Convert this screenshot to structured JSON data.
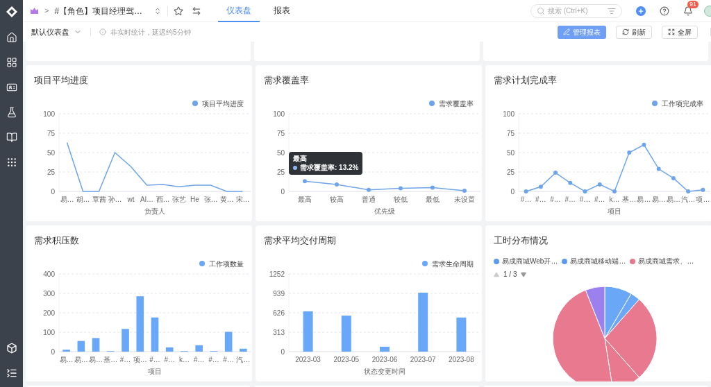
{
  "header": {
    "breadcrumb_separator": ">",
    "project_title": "#【角色】项目经理驾…",
    "tabs": [
      {
        "label": "仪表盘",
        "selected": true
      },
      {
        "label": "报表",
        "selected": false
      }
    ],
    "search": {
      "placeholder": "搜索 (Ctrl+K)"
    },
    "notification_count": "91"
  },
  "toolbar": {
    "dashboard_name": "默认仪表盘",
    "notice": "非实时统计，延迟约5分钟",
    "buttons": [
      {
        "label": "管理报表",
        "kind": "primary"
      },
      {
        "label": "刷新",
        "kind": "refresh"
      },
      {
        "label": "全屏",
        "kind": "fullscreen"
      }
    ]
  },
  "cards": [
    {
      "kind": "chart",
      "title": "项目平均进度",
      "chart_data": {
        "type": "line",
        "grid": true,
        "xlabel": "负责人",
        "categories": [
          "易…",
          "胡…",
          "覃茜",
          "孙…",
          "wt",
          "Al…",
          "西…",
          "张艺",
          "He",
          "张…",
          "黄…",
          "宋…"
        ],
        "ylim": [
          0,
          100
        ],
        "yticks": [
          0,
          25,
          50,
          75,
          100
        ],
        "series": [
          {
            "name": "项目平均进度",
            "color": "#6ea4ea",
            "marker": false,
            "values": [
              63,
              0,
              0,
              50,
              32,
              8,
              9,
              6,
              8,
              8,
              0,
              0
            ]
          }
        ]
      }
    },
    {
      "kind": "chart",
      "title": "需求覆盖率",
      "tooltip": {
        "title": "最高",
        "text": "需求覆盖率: 13.2%"
      },
      "chart_data": {
        "type": "line",
        "grid": true,
        "xlabel": "优先级",
        "categories": [
          "最高",
          "较高",
          "普通",
          "较低",
          "最低",
          "未设置"
        ],
        "ylim": [
          0,
          100
        ],
        "yticks": [
          0,
          25,
          50,
          75,
          100
        ],
        "series": [
          {
            "name": "需求覆盖率",
            "color": "#6ea4ea",
            "marker": true,
            "values": [
              13.2,
              9,
              2,
              4,
              5,
              1
            ]
          }
        ]
      }
    },
    {
      "kind": "chart",
      "title": "需求计划完成率",
      "chart_data": {
        "type": "line",
        "grid": true,
        "xlabel": "项目",
        "categories": [
          "#…",
          "#…",
          "#…",
          "#…",
          "#…",
          "#…",
          "k…",
          "基…",
          "易…",
          "易…",
          "易…",
          "汽…",
          "项…"
        ],
        "ylim": [
          0,
          100
        ],
        "yticks": [
          0,
          25,
          50,
          75,
          100
        ],
        "series": [
          {
            "name": "工作项完成率",
            "color": "#6ea4ea",
            "marker": true,
            "values": [
              0,
              6,
              24,
              11,
              0,
              9,
              0,
              50,
              60,
              29,
              17,
              0,
              2
            ]
          }
        ]
      }
    },
    {
      "kind": "chart",
      "title": "需求积压数",
      "chart_data": {
        "type": "bar",
        "grid": true,
        "xlabel": "项目",
        "categories": [
          "易…",
          "易…",
          "易…",
          "基…",
          "#…",
          "项…",
          "#…",
          "#…",
          "k…",
          "#…",
          "#…",
          "#…",
          "汽…"
        ],
        "ylim": [
          0,
          400
        ],
        "yticks": [
          0,
          100,
          200,
          300,
          400
        ],
        "series": [
          {
            "name": "工作项数量",
            "color": "#69a7f8",
            "values": [
              10,
              55,
              70,
              3,
              117,
              285,
              176,
              22,
              3,
              33,
              3,
              102,
              15
            ]
          }
        ]
      }
    },
    {
      "kind": "chart",
      "title": "需求平均交付周期",
      "chart_data": {
        "type": "bar",
        "grid": true,
        "xlabel": "状态变更时间",
        "categories": [
          "2023-03",
          "2023-05",
          "2023-06",
          "2023-07",
          "2023-08"
        ],
        "ylim": [
          0,
          1252
        ],
        "yticks": [
          0,
          313,
          626,
          939,
          1252
        ],
        "series": [
          {
            "name": "需求生命周期",
            "color": "#69a7f8",
            "values": [
              650,
              580,
              80,
              950,
              550
            ]
          }
        ]
      }
    },
    {
      "kind": "pie",
      "title": "工时分布情况",
      "pager": "1 / 3",
      "legend": [
        {
          "label": "易成商城Web开…",
          "color": "#5b9bf0"
        },
        {
          "label": "易成商城移动端…",
          "color": "#5b9bf0"
        },
        {
          "label": "易成商城需求、…",
          "color": "#e5788c"
        }
      ]
    }
  ]
}
